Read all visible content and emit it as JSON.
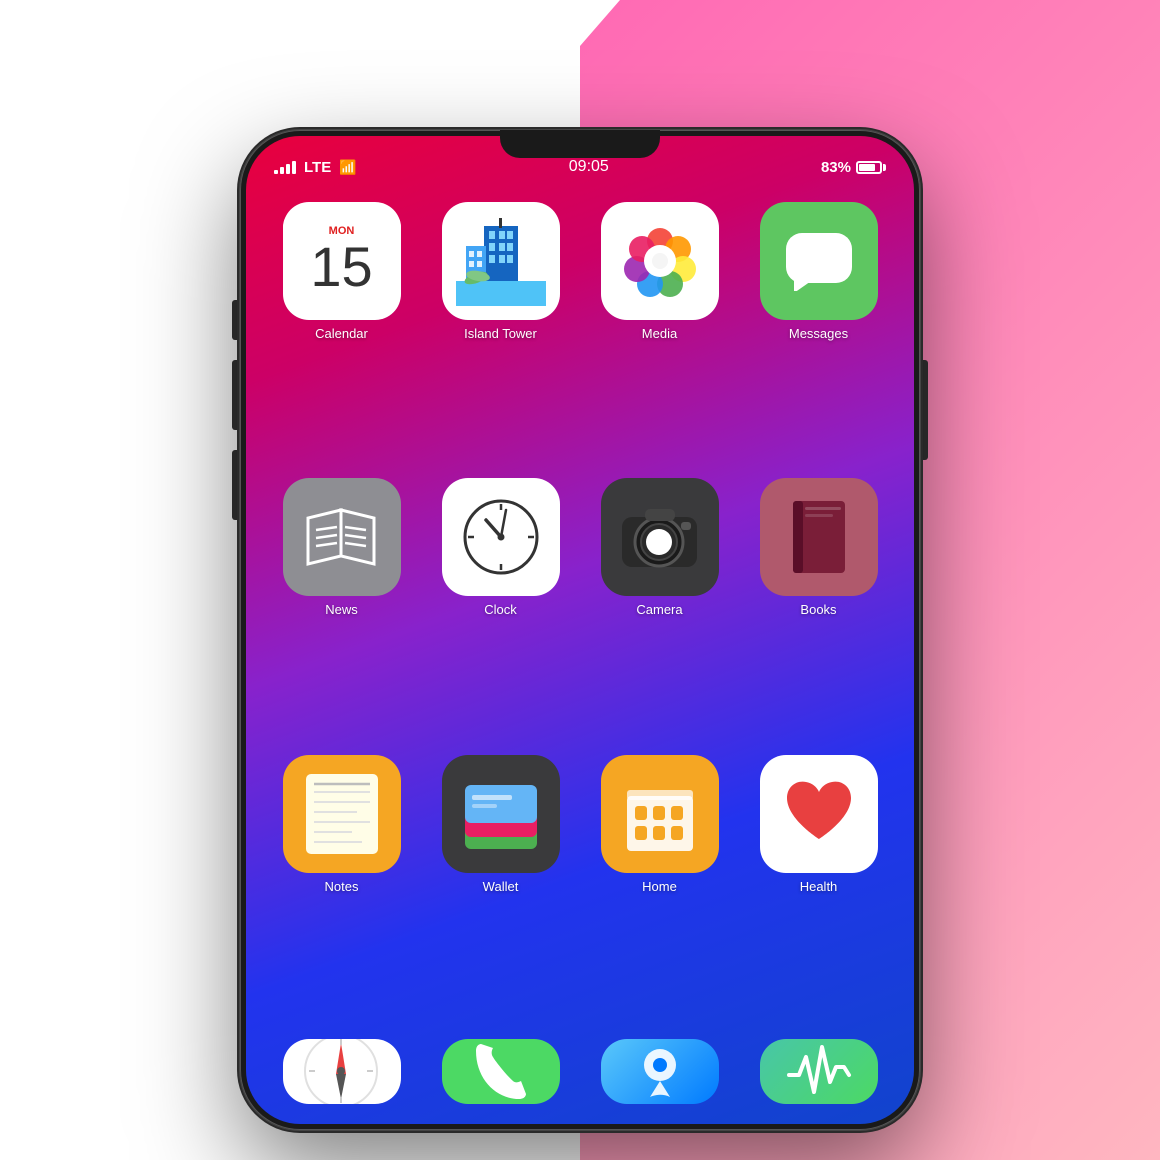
{
  "background": {
    "left_color": "#ffffff",
    "right_gradient_start": "#ff69b4",
    "right_gradient_end": "#ffb6c1"
  },
  "status_bar": {
    "signal": "●●●●",
    "network": "LTE",
    "wifi": "wifi",
    "time": "09:05",
    "battery_pct": "83%"
  },
  "apps": [
    {
      "id": "calendar",
      "label": "Calendar",
      "date": "15",
      "month": "MON"
    },
    {
      "id": "island-tower",
      "label": "Island Tower"
    },
    {
      "id": "media",
      "label": "Media"
    },
    {
      "id": "messages",
      "label": "Messages"
    },
    {
      "id": "news",
      "label": "News"
    },
    {
      "id": "clock",
      "label": "Clock"
    },
    {
      "id": "camera",
      "label": "Camera"
    },
    {
      "id": "books",
      "label": "Books"
    },
    {
      "id": "notes",
      "label": "Notes"
    },
    {
      "id": "wallet",
      "label": "Wallet"
    },
    {
      "id": "home",
      "label": "Home"
    },
    {
      "id": "health",
      "label": "Health"
    }
  ],
  "partial_apps": [
    {
      "id": "compass",
      "label": ""
    },
    {
      "id": "phone",
      "label": ""
    },
    {
      "id": "maps",
      "label": ""
    },
    {
      "id": "fitness",
      "label": ""
    }
  ]
}
